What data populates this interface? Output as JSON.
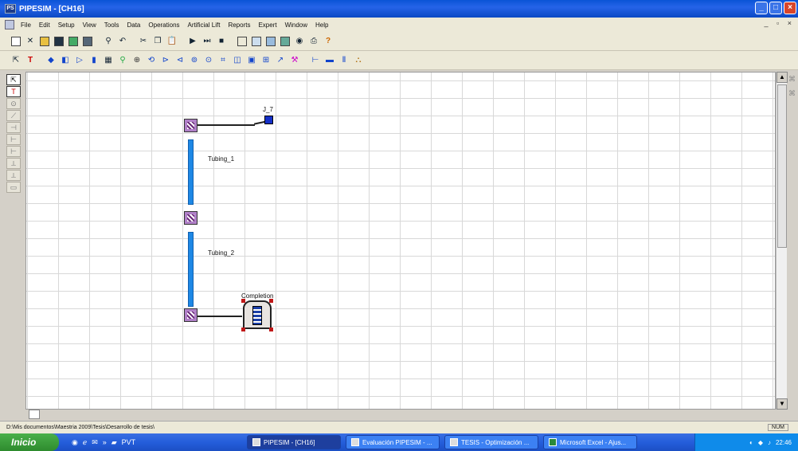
{
  "window": {
    "title": "PIPESIM - [CH16]",
    "app_icon": "pipesim-icon",
    "controls": [
      "_",
      "□",
      "×"
    ]
  },
  "menu": {
    "items": [
      "File",
      "Edit",
      "Setup",
      "View",
      "Tools",
      "Data",
      "Operations",
      "Artificial Lift",
      "Reports",
      "Expert",
      "Window",
      "Help"
    ],
    "mdi_controls": "_ ▫ ×"
  },
  "toolbar1": {
    "icons": [
      "new-icon",
      "cut-icon",
      "open-icon",
      "save-icon",
      "grid-icon",
      "print-icon",
      "find-icon",
      "undo-icon",
      "cut2-icon",
      "copy-icon",
      "paste-icon",
      "run-icon",
      "step-icon",
      "stop-icon",
      "layout-icon",
      "layout2-icon",
      "table-icon",
      "chart-icon",
      "globe-icon",
      "printer-icon",
      "help-icon"
    ]
  },
  "toolbar2": {
    "icons": [
      "select-icon",
      "text-icon",
      "node-icon",
      "source-icon",
      "sink-icon",
      "well-icon",
      "tubing-icon",
      "choke-icon",
      "pump-icon",
      "compressor-icon",
      "separator-icon",
      "heater-icon",
      "flowline-icon",
      "injection-icon",
      "junction-icon",
      "multiplier-icon",
      "report-icon",
      "measure-icon",
      "gas-lift-icon",
      "completion-icon",
      "riser-icon"
    ]
  },
  "palette": {
    "icons": [
      "pointer-icon",
      "text-tool-icon",
      "p1-icon",
      "p2-icon",
      "p3-icon",
      "p4-icon",
      "p5-icon",
      "p6-icon",
      "p7-icon",
      "p8-icon"
    ]
  },
  "diagram": {
    "sink_label": "J_7",
    "tubing1_label": "Tubing_1",
    "tubing2_label": "Tubing_2",
    "completion_label": "Completion"
  },
  "status": {
    "path": "D:\\Mis documentos\\Maestria 2009\\Tesis\\Desarrollo de tesis\\",
    "num": "NUM"
  },
  "taskbar": {
    "start_label": "Inicio",
    "quicklaunch_label": "PVT",
    "tasks": [
      {
        "label": "PIPESIM - [CH16]",
        "active": true
      },
      {
        "label": "Evaluación PIPESIM - ...",
        "active": false
      },
      {
        "label": "TESIS - Optimización ...",
        "active": false
      },
      {
        "label": "Microsoft Excel - Ajus...",
        "active": false
      }
    ],
    "clock": "22:46"
  }
}
